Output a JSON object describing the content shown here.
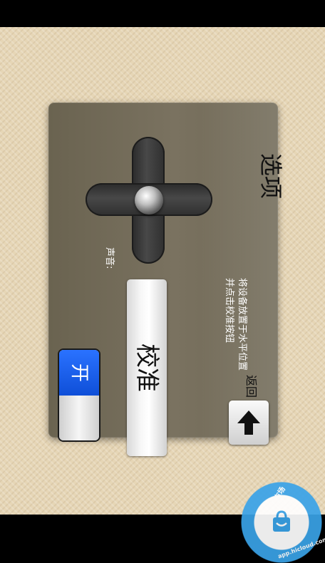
{
  "dialog": {
    "title": "选项",
    "instructions": "将设备放置于水平位置并点击校准按钮",
    "sound_label": "声音:",
    "calibrate_label": "校准",
    "toggle_on_label": "开",
    "back_label": "返回"
  },
  "watermark": {
    "text": "智汇云应用市场",
    "url": "app.hicloud.com"
  }
}
